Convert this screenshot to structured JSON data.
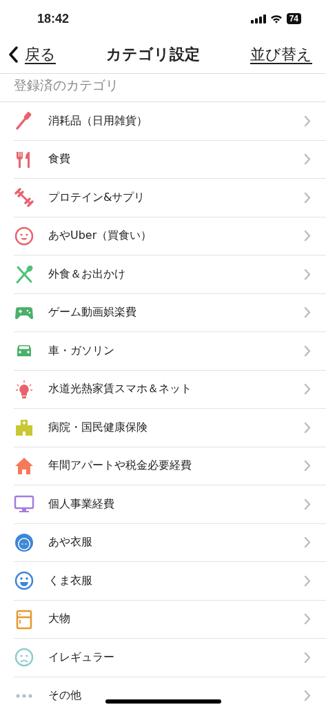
{
  "status_bar": {
    "time": "18:42",
    "battery": "74"
  },
  "nav": {
    "back": "戻る",
    "title": "カテゴリ設定",
    "action": "並び替え"
  },
  "section_title": "登録済のカテゴリ",
  "categories": [
    {
      "label": "消耗品（日用雑貨）",
      "color": "#e8626e"
    },
    {
      "label": "食費",
      "color": "#e8626e"
    },
    {
      "label": "プロテイン&サプリ",
      "color": "#e8626e"
    },
    {
      "label": "あやUber（買食い）",
      "color": "#e8626e"
    },
    {
      "label": "外食＆お出かけ",
      "color": "#4cc27a"
    },
    {
      "label": "ゲーム動画娯楽費",
      "color": "#4bb06a"
    },
    {
      "label": "車・ガソリン",
      "color": "#4bb06a"
    },
    {
      "label": "水道光熱家賃スマホ＆ネット",
      "color": "#e8626e"
    },
    {
      "label": "病院・国民健康保険",
      "color": "#c8c832"
    },
    {
      "label": "年間アパートや税金必要経費",
      "color": "#f47a5a"
    },
    {
      "label": "個人事業経費",
      "color": "#a37ce0"
    },
    {
      "label": "あや衣服",
      "color": "#3d86d8"
    },
    {
      "label": "くま衣服",
      "color": "#3d86d8"
    },
    {
      "label": "大物",
      "color": "#e8962e"
    },
    {
      "label": "イレギュラー",
      "color": "#8ecbcf"
    },
    {
      "label": "その他",
      "color": "#a8bfd0"
    }
  ]
}
